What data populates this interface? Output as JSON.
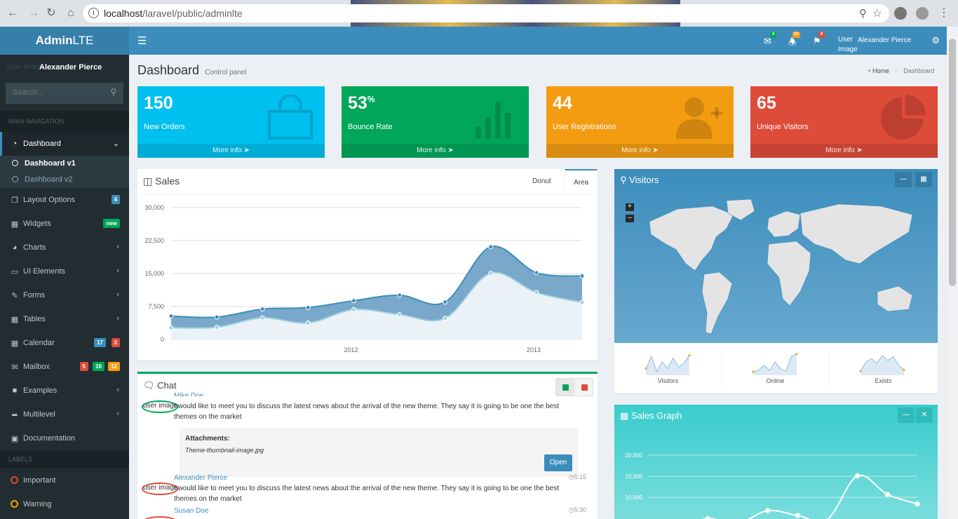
{
  "browser": {
    "url_host": "localhost",
    "url_path": "/laravel/public/adminlte"
  },
  "logo": {
    "bold": "Admin",
    "light": "LTE"
  },
  "user": {
    "image_alt": "User Image",
    "name": "Alexander Pierce"
  },
  "sidebar": {
    "search_placeholder": "Search...",
    "header_main": "MAIN NAVIGATION",
    "dashboard": "Dashboard",
    "dashboard_v1": "Dashboard v1",
    "dashboard_v2": "Dashboard v2",
    "items": [
      {
        "label": "Layout Options",
        "badge": "4"
      },
      {
        "label": "Widgets",
        "badge": "new"
      },
      {
        "label": "Charts"
      },
      {
        "label": "UI Elements"
      },
      {
        "label": "Forms"
      },
      {
        "label": "Tables"
      },
      {
        "label": "Calendar",
        "badges": [
          "17",
          "3"
        ]
      },
      {
        "label": "Mailbox",
        "badges": [
          "5",
          "16",
          "12"
        ]
      },
      {
        "label": "Examples"
      },
      {
        "label": "Multilevel"
      },
      {
        "label": "Documentation"
      }
    ],
    "header_labels": "LABELS",
    "labels": [
      "Important",
      "Warning"
    ]
  },
  "topbar": {
    "messages_count": "4",
    "notifications_count": "10",
    "tasks_count": "9",
    "user_image_alt": "User Image",
    "user_name": "Alexander Pierce"
  },
  "page": {
    "title": "Dashboard",
    "subtitle": "Control panel"
  },
  "breadcrumb": {
    "home": "Home",
    "current": "Dashboard"
  },
  "stat_boxes": [
    {
      "value": "150",
      "suffix": "",
      "label": "New Orders",
      "link": "More info",
      "color": "#00c0ef"
    },
    {
      "value": "53",
      "suffix": "%",
      "label": "Bounce Rate",
      "link": "More info",
      "color": "#00a65a"
    },
    {
      "value": "44",
      "suffix": "",
      "label": "User Registrations",
      "link": "More info",
      "color": "#f39c12"
    },
    {
      "value": "65",
      "suffix": "",
      "label": "Unique Visitors",
      "link": "More info",
      "color": "#dd4b39"
    }
  ],
  "sales": {
    "title": "Sales",
    "tabs": [
      "Area",
      "Donut"
    ],
    "active_tab": "Area"
  },
  "chart_data": [
    {
      "type": "area",
      "title": "",
      "x_ticks": [
        "2012",
        "2013"
      ],
      "y_ticks": [
        "30,000",
        "22,500",
        "15,000",
        "7,500",
        "0"
      ],
      "ylim": [
        0,
        30000
      ],
      "x": [
        "2011 Q1",
        "2011 Q2",
        "2011 Q3",
        "2011 Q4",
        "2012 Q1",
        "2012 Q2",
        "2012 Q3",
        "2012 Q4",
        "2013 Q1",
        "2013 Q2"
      ],
      "series": [
        {
          "values": [
            2666,
            2778,
            4912,
            3767,
            6810,
            5670,
            4820,
            15073,
            10687,
            8432
          ],
          "color": "#a0d0e0"
        },
        {
          "values": [
            5332,
            5078,
            6912,
            7267,
            8810,
            10070,
            8520,
            21073,
            15187,
            14432
          ],
          "color": "#3c8dbc"
        }
      ]
    },
    {
      "type": "line",
      "title": "Sales Graph",
      "y_ticks": [
        "20,000",
        "15,000",
        "10,000"
      ],
      "ylim": [
        5000,
        22000
      ],
      "values": [
        2666,
        2778,
        4912,
        3767,
        6810,
        5670,
        4820,
        15073,
        10687,
        8432
      ]
    }
  ],
  "chat": {
    "title": "Chat",
    "messages": [
      {
        "name": "Mike Doe",
        "image_alt": "user image",
        "text": "I would like to meet you to discuss the latest news about the arrival of the new theme. They say it is going to be one the best themes on the market",
        "ring": "#00a65a"
      },
      {
        "name": "Alexander Pierce",
        "time": "5:15",
        "image_alt": "user image",
        "text": "I would like to meet you to discuss the latest news about the arrival of the new theme. They say it is going to be one the best themes on the market",
        "ring": "#dd4b39"
      },
      {
        "name": "Susan Doe",
        "time": "5:30"
      }
    ],
    "attachment_title": "Attachments:",
    "attachment_file": "Theme-thumbnail-image.jpg",
    "open_button": "Open"
  },
  "visitors": {
    "title": "Visitors",
    "sparklines": [
      "Visitors",
      "Online",
      "Exists"
    ]
  },
  "sales_graph": {
    "title": "Sales Graph"
  }
}
